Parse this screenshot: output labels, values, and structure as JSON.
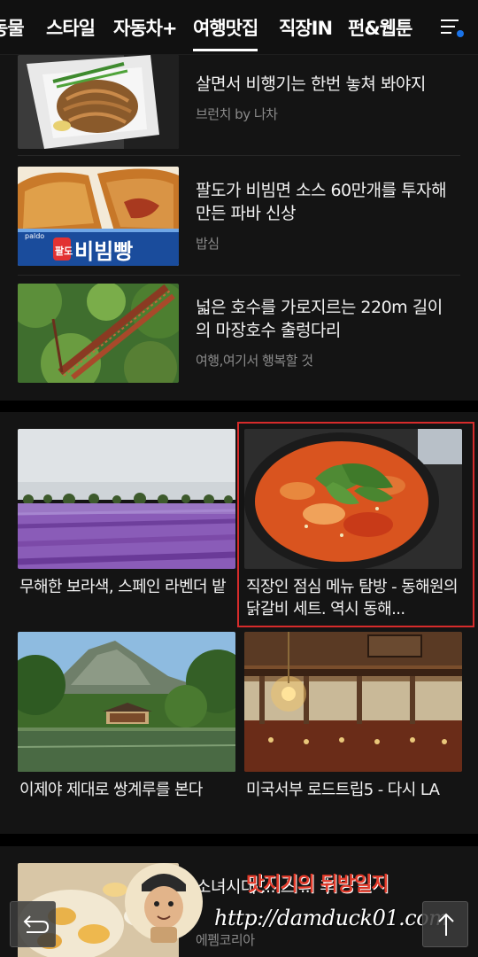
{
  "tabs": [
    {
      "label": "동물"
    },
    {
      "label": "스타일"
    },
    {
      "label": "자동차+"
    },
    {
      "label": "여행맛집"
    },
    {
      "label": "직장IN"
    },
    {
      "label": "펀&웹툰"
    }
  ],
  "active_tab": "여행맛집",
  "list_articles": [
    {
      "title": "살면서 비행기는 한번 놓쳐 봐야지",
      "source": "브런치 by 나차"
    },
    {
      "title": "팔도가 비빔면 소스 60만개를 투자해 만든 파바 신상",
      "source": "밥심",
      "thumb_text": "비빔빵",
      "thumb_badge": "팔도",
      "thumb_brand": "paldo"
    },
    {
      "title": "넓은 호수를 가로지르는 220m 길이의 마장호수 출렁다리",
      "source": "여행,여기서 행복할 것"
    }
  ],
  "grid_articles": [
    {
      "title": "무해한 보라색, 스페인 라벤더 밭"
    },
    {
      "title": "직장인 점심 메뉴 탐방 - 동해원의 닭갈비 세트. 역시 동해..."
    },
    {
      "title": "이제야 제대로 쌍계루를 본다"
    },
    {
      "title": "미국서부 로드트립5 - 다시 LA"
    }
  ],
  "bottom_article": {
    "title": "소녀시대 ... 스 ... 후",
    "source": "에펨코리아"
  },
  "watermark": {
    "name": "맛지기의 뒤방일지",
    "url": "http://damduck01.com"
  },
  "colors": {
    "highlight": "#d62b2b",
    "notification_dot": "#1a73e8"
  },
  "icons": {
    "menu": "menu-icon",
    "back": "back-arrow-icon",
    "top": "arrow-up-icon"
  }
}
